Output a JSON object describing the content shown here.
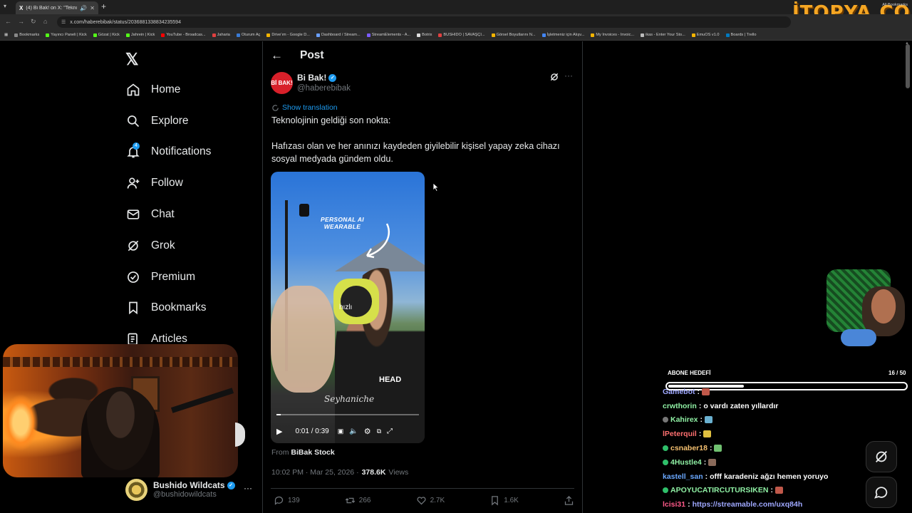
{
  "browser": {
    "tab_title": "(4) Bi Bak! on X: \"Teknoloji...",
    "tab_favicon": "X",
    "url": "x.com/haberebibak/status/2036881338834235594",
    "bookmarks": [
      {
        "label": "Bookmarks",
        "color": "#888888"
      },
      {
        "label": "Yayıncı Paneli | Kick",
        "color": "#53fc18"
      },
      {
        "label": "Gözat | Kick",
        "color": "#53fc18"
      },
      {
        "label": "Jahrein | Kick",
        "color": "#53fc18"
      },
      {
        "label": "YouTube - Broadcas...",
        "color": "#ff0000"
      },
      {
        "label": "Jaharia",
        "color": "#e04040"
      },
      {
        "label": "Oturum Aç",
        "color": "#3a7bd5"
      },
      {
        "label": "Drive'ım - Google D...",
        "color": "#f4b400"
      },
      {
        "label": "Dashboard / Stream...",
        "color": "#6aa0ff"
      },
      {
        "label": "StreamElements - A...",
        "color": "#7b5cff"
      },
      {
        "label": "Botrix",
        "color": "#dddddd"
      },
      {
        "label": "BUSHIDO | SAVAŞÇI...",
        "color": "#e04040"
      },
      {
        "label": "Görsel Boyutlarını N...",
        "color": "#f4b400"
      },
      {
        "label": "İşletmeniz için Alışv...",
        "color": "#4285f4"
      },
      {
        "label": "My Invoices - Invoic...",
        "color": "#f4b400"
      },
      {
        "label": "ikas - Enter Your Sto...",
        "color": "#bbbbbb"
      },
      {
        "label": "EmuOS v1.0",
        "color": "#f4b400"
      },
      {
        "label": "Boards | Trello",
        "color": "#0079bf"
      }
    ],
    "all_bookmarks": "All Bookmarks",
    "brand_overlay": "İTOPYA.COM"
  },
  "nav": {
    "items": [
      {
        "label": "Home",
        "icon": "home-icon",
        "bold": true
      },
      {
        "label": "Explore",
        "icon": "search-icon"
      },
      {
        "label": "Notifications",
        "icon": "bell-icon",
        "badge": "4"
      },
      {
        "label": "Follow",
        "icon": "add-person-icon"
      },
      {
        "label": "Chat",
        "icon": "mail-icon"
      },
      {
        "label": "Grok",
        "icon": "grok-icon"
      },
      {
        "label": "Premium",
        "icon": "verified-icon"
      },
      {
        "label": "Bookmarks",
        "icon": "bookmark-icon"
      },
      {
        "label": "Articles",
        "icon": "article-icon"
      }
    ]
  },
  "account": {
    "name": "Bushido Wildcats",
    "handle": "@bushidowildcats"
  },
  "post": {
    "header_title": "Post",
    "author_name": "Bi Bak!",
    "author_handle": "@haberebibak",
    "avatar_text": "Bİ BAK!",
    "show_translation": "Show translation",
    "text": "Teknolojinin geldiği son nokta:\n\nHafızası olan ve her anınızı kaydeden giyilebilir kişisel yapay zeka cihazı sosyal medyada gündem oldu.",
    "video": {
      "overlay_text": "PERSONAL AI\nWEARABLE",
      "caption": "hızlı",
      "brand": "HEAD",
      "signature": "Seyhaniche",
      "time": "0:01 / 0:39",
      "progress": 0.03
    },
    "from_label": "From",
    "from_source": "BiBak Stock",
    "timestamp": "10:02 PM · Mar 25, 2026 ·",
    "views_count": "378.6K",
    "views_label": "Views",
    "replies": "139",
    "reposts": "266",
    "likes": "2.7K",
    "bookmarks": "1.6K"
  },
  "stream": {
    "sub_goal_title": "ABONE HEDEFİ",
    "sub_goal_count": "16 / 50",
    "sub_goal_progress": 0.32,
    "chat": [
      {
        "user": "Gamebot",
        "color": "#9fa8ff",
        "msg": "",
        "emoji": "#c0584a",
        "badge": false
      },
      {
        "user": "crwthorin",
        "color": "#8ff0a4",
        "msg": "o vardı zaten yıllardır",
        "badge": false
      },
      {
        "user": "Kahirex",
        "color": "#8ff0a4",
        "msg": "",
        "emoji": "#6ab0d0",
        "badge": true,
        "badge_color": "#777777"
      },
      {
        "user": "lPeterquil",
        "color": "#ff7070",
        "msg": "",
        "emoji": "#e0c040",
        "badge": false
      },
      {
        "user": "csnaber18",
        "color": "#f5c070",
        "msg": "",
        "emoji": "#70c070",
        "badge": true,
        "badge_color": "#2fbf6a"
      },
      {
        "user": "4Hustle4",
        "color": "#8ff0a4",
        "msg": "",
        "emoji": "#8a6a5a",
        "badge": true,
        "badge_color": "#2fbf6a"
      },
      {
        "user": "kastell_san",
        "color": "#6aa8ff",
        "msg": "offf karadeniz ağzı hemen yoruyo",
        "badge": false
      },
      {
        "user": "APOYUCATIRCUTURSIKEN",
        "color": "#8ff0a4",
        "msg": "",
        "emoji": "#c0584a",
        "badge": true,
        "badge_color": "#2fbf6a"
      },
      {
        "user": "lcisi31",
        "color": "#ff5a8a",
        "msg": "",
        "link": "https://streamable.com/uxq84h",
        "badge": false
      }
    ]
  }
}
